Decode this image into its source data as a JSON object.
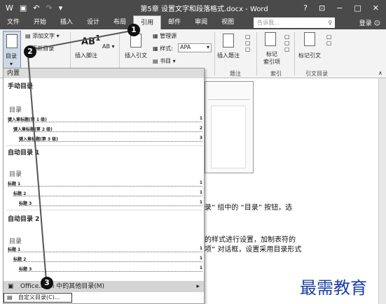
{
  "titlebar": {
    "title": "第5章 设置文字和段落格式.docx - Word",
    "help": "?",
    "ribbon_opts": "⊡",
    "min": "−",
    "max": "□",
    "close": "✕"
  },
  "tabs": [
    "文件",
    "开始",
    "插入",
    "设计",
    "布局",
    "引用",
    "邮件",
    "审阅",
    "视图"
  ],
  "tell_me": {
    "placeholder": "告诉我..."
  },
  "login": "登录",
  "ribbon": {
    "toc_button": "目录",
    "add_text": "添加文字 ▾",
    "update_toc": "更新目录",
    "insert_footnote": "插入脚注",
    "ab": "AB",
    "insert_citation": "插入引文",
    "manage_sources": "管理源",
    "style_label": "样式:",
    "style_value": "APA",
    "bibliography": "书目 ▾",
    "insert_caption": "插入题注",
    "mark_entry": "标记",
    "index_entry": "索引项",
    "mark_citation": "标记引文",
    "group_caption": "题注",
    "group_index": "索引",
    "group_toa": "引文目录"
  },
  "dropdown": {
    "header": "内置",
    "sections": [
      {
        "title": "手动目录",
        "heading": "目录",
        "lines": [
          {
            "text": "键入章标题(第 1 级)",
            "page": "1"
          },
          {
            "text": "键入章标题(第 2 级)",
            "page": "2"
          },
          {
            "text": "键入章标题(第 3 级)",
            "page": "3"
          }
        ]
      },
      {
        "title": "自动目录 1",
        "heading": "目录",
        "lines": [
          {
            "text": "标题 1",
            "page": "1"
          },
          {
            "text": "标题 2",
            "page": "1"
          },
          {
            "text": "标题 3",
            "page": "1"
          }
        ]
      },
      {
        "title": "自动目录 2",
        "heading": "目录",
        "lines": [
          {
            "text": "标题 1",
            "page": "1"
          },
          {
            "text": "标题 2",
            "page": "1"
          },
          {
            "text": "标题 3",
            "page": "1"
          }
        ]
      }
    ],
    "more": "Office.com 中的其他目录(M)",
    "custom": "自定义目录(C)..."
  },
  "document": {
    "line1": "录” 组中的 “目录” 按钮，选",
    "line2": "的样式进行设置，加制表符的",
    "line3": "项” 对话框，设置采用目录形式"
  },
  "callouts": [
    "1",
    "2",
    "3"
  ],
  "watermark": "最需教育",
  "colors": {
    "callout": "#111111",
    "watermark": "#1a3fa6",
    "arrow": "#555555"
  }
}
